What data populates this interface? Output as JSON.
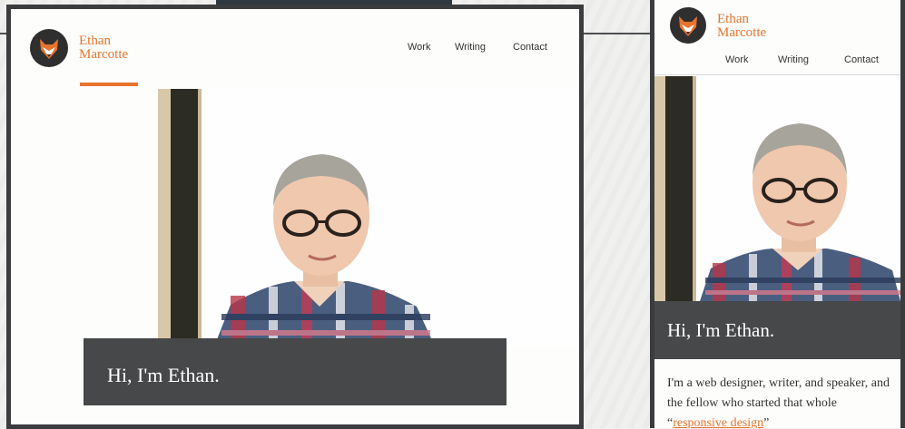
{
  "site": {
    "name_line1": "Ethan",
    "name_line2": "Marcotte",
    "logo_icon": "fox-logo-icon"
  },
  "nav": {
    "items": [
      "Work",
      "Writing",
      "Contact"
    ]
  },
  "hero": {
    "greeting": "Hi, I'm Ethan."
  },
  "mobile": {
    "intro_part1": "I'm a web designer, writer, and speaker, and the fellow who started that whole “",
    "intro_link": "responsive design",
    "intro_part2": "”"
  },
  "colors": {
    "accent": "#e8732d",
    "hero_bg": "#464849",
    "frame": "#3a3c3d"
  }
}
